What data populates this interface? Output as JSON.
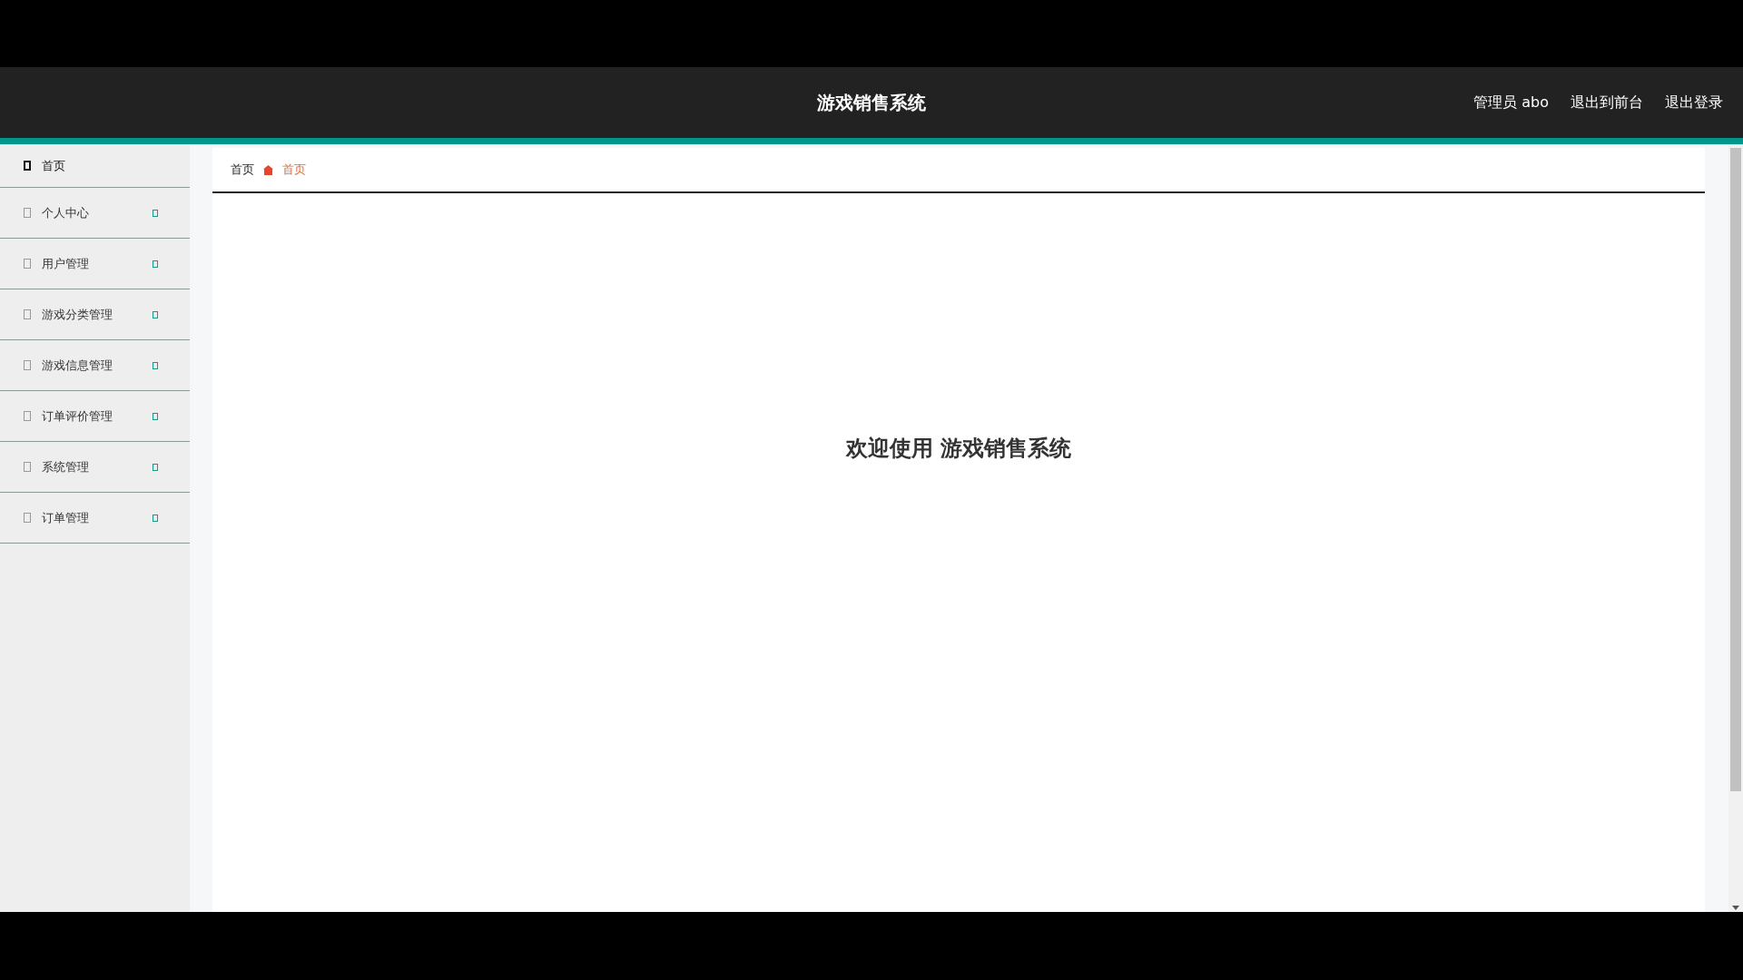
{
  "header": {
    "title": "游戏销售系统",
    "user": "管理员 abo",
    "links": [
      "退出到前台",
      "退出登录"
    ]
  },
  "sidebar": {
    "items": [
      {
        "label": "首页",
        "kind": "link",
        "selected": true
      },
      {
        "label": "个人中心",
        "kind": "group",
        "selected": false
      },
      {
        "label": "用户管理",
        "kind": "group",
        "selected": false
      },
      {
        "label": "游戏分类管理",
        "kind": "group",
        "selected": false
      },
      {
        "label": "游戏信息管理",
        "kind": "group",
        "selected": false
      },
      {
        "label": "订单评价管理",
        "kind": "group",
        "selected": false
      },
      {
        "label": "系统管理",
        "kind": "group",
        "selected": false
      },
      {
        "label": "订单管理",
        "kind": "group",
        "selected": false
      }
    ]
  },
  "breadcrumb": [
    "首页",
    "首页"
  ],
  "welcome": "欢迎使用 游戏销售系统"
}
